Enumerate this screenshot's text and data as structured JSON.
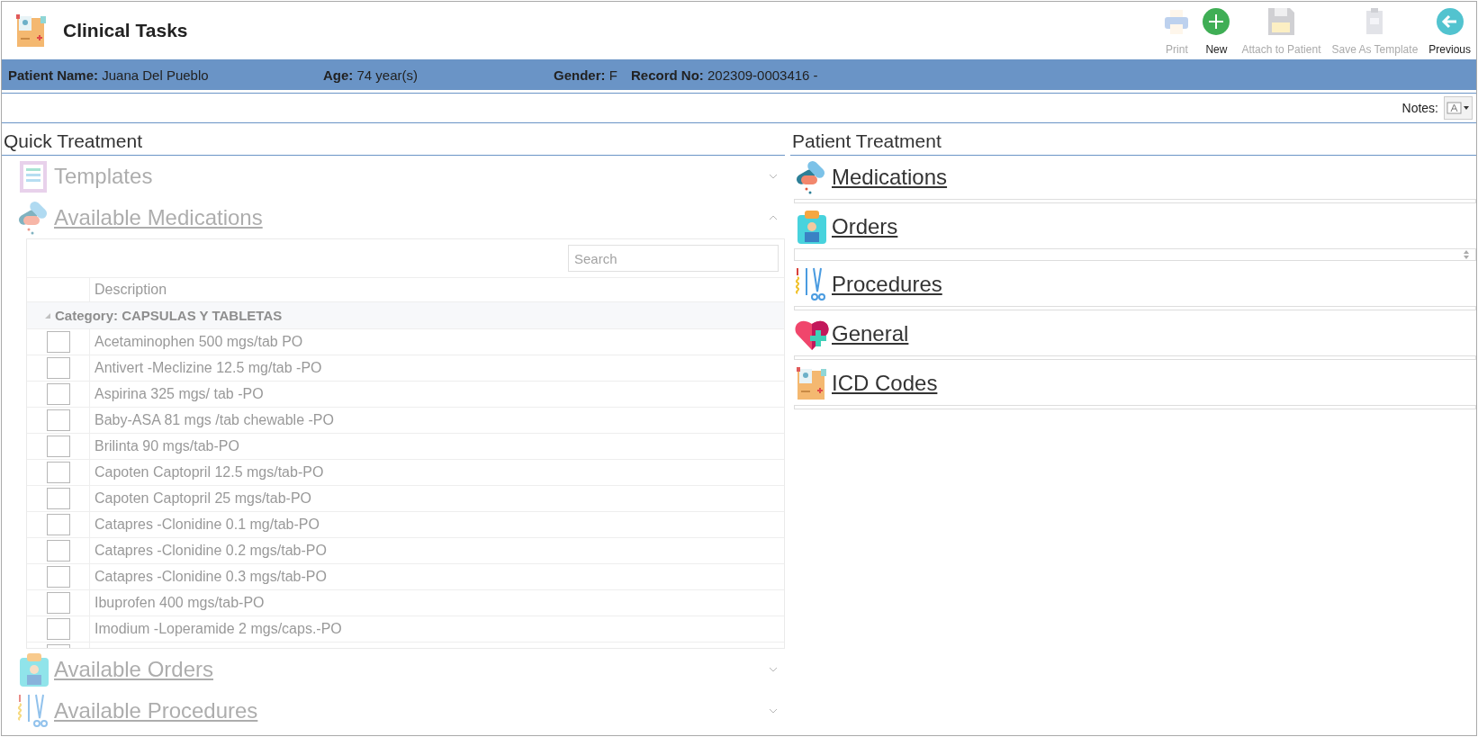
{
  "window": {
    "title": "Clinical Tasks"
  },
  "toolbar": [
    {
      "label": "Print",
      "kind": "print",
      "disabled": true
    },
    {
      "label": "New",
      "kind": "new",
      "disabled": false
    },
    {
      "label": "Attach to Patient",
      "kind": "save",
      "disabled": true
    },
    {
      "label": "Save As Template",
      "kind": "template",
      "disabled": true
    },
    {
      "label": "Previous",
      "kind": "previous",
      "disabled": false
    }
  ],
  "patient": [
    {
      "label": "Patient Name:",
      "value": "Juana Del Pueblo"
    },
    {
      "label": "Age:",
      "value": "74 year(s)"
    },
    {
      "label": "Gender:",
      "value": "F"
    },
    {
      "label": "Record No:",
      "value": "202309-0003416 -"
    }
  ],
  "notes": {
    "label": "Notes:"
  },
  "quick_treatment": {
    "title": "Quick Treatment",
    "disabled": true,
    "sections": [
      {
        "label": "Templates",
        "kind": "templates",
        "link": false,
        "expanded": false
      },
      {
        "label": "Available Medications",
        "kind": "medications",
        "link": true,
        "expanded": true
      },
      {
        "label": "Available Orders",
        "kind": "orders",
        "link": true,
        "expanded": false
      },
      {
        "label": "Available Procedures",
        "kind": "procedures",
        "link": true,
        "expanded": false
      }
    ],
    "grid": {
      "search_placeholder": "Search",
      "columns": [
        "Description"
      ],
      "group": "Category: CAPSULAS Y TABLETAS",
      "rows": [
        {
          "description": "Acetaminophen 500 mgs/tab PO",
          "checked": false
        },
        {
          "description": "Antivert -Meclizine 12.5 mg/tab -PO",
          "checked": false
        },
        {
          "description": "Aspirina 325 mgs/ tab -PO",
          "checked": false
        },
        {
          "description": "Baby-ASA 81 mgs /tab chewable -PO",
          "checked": false
        },
        {
          "description": "Brilinta 90 mgs/tab-PO",
          "checked": false
        },
        {
          "description": "Capoten Captopril 12.5 mgs/tab-PO",
          "checked": false
        },
        {
          "description": "Capoten Captopril 25 mgs/tab-PO",
          "checked": false
        },
        {
          "description": "Catapres -Clonidine 0.1 mg/tab-PO",
          "checked": false
        },
        {
          "description": "Catapres -Clonidine 0.2 mgs/tab-PO",
          "checked": false
        },
        {
          "description": "Catapres -Clonidine 0.3 mgs/tab-PO",
          "checked": false
        },
        {
          "description": "Ibuprofen 400 mgs/tab-PO",
          "checked": false
        },
        {
          "description": "Imodium -Loperamide 2 mgs/caps.-PO",
          "checked": false
        }
      ]
    }
  },
  "patient_treatment": {
    "title": "Patient Treatment",
    "items": [
      {
        "label": "Medications",
        "kind": "medications",
        "spinner": false
      },
      {
        "label": "Orders",
        "kind": "orders",
        "spinner": true
      },
      {
        "label": "Procedures",
        "kind": "procedures",
        "spinner": false
      },
      {
        "label": "General",
        "kind": "general",
        "spinner": false
      },
      {
        "label": "ICD Codes",
        "kind": "icd",
        "spinner": false
      }
    ]
  }
}
